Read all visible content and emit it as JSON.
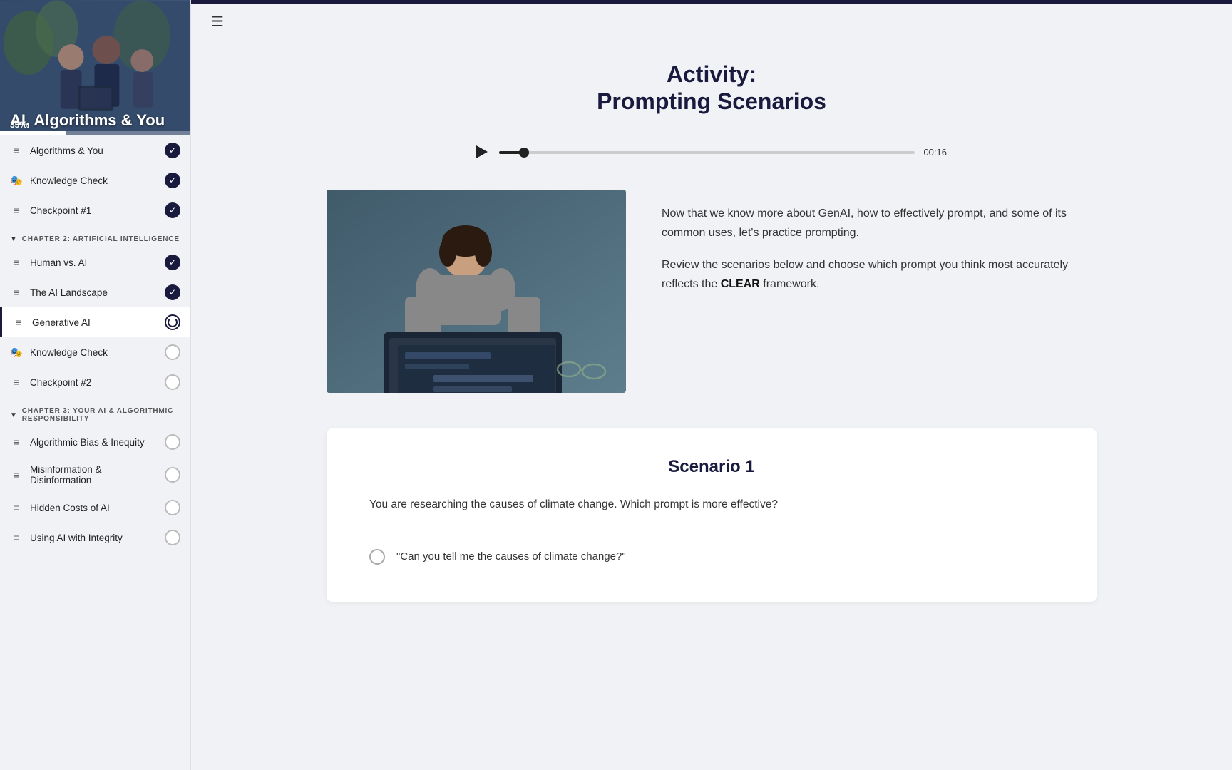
{
  "sidebar": {
    "hero": {
      "title": "AI, Algorithms & You",
      "progress_percent": 35,
      "progress_label": "35%"
    },
    "chapters": [
      {
        "type": "items",
        "items": [
          {
            "id": "algorithms-you",
            "label": "Algorithms & You",
            "icon": "≡",
            "status": "complete"
          },
          {
            "id": "knowledge-check-1",
            "label": "Knowledge Check",
            "icon": "🎭",
            "status": "complete"
          },
          {
            "id": "checkpoint-1",
            "label": "Checkpoint #1",
            "icon": "≡",
            "status": "complete"
          }
        ]
      },
      {
        "type": "chapter",
        "title": "CHAPTER 2: ARTIFICIAL INTELLIGENCE",
        "items": [
          {
            "id": "human-vs-ai",
            "label": "Human vs. AI",
            "icon": "≡",
            "status": "complete"
          },
          {
            "id": "ai-landscape",
            "label": "The AI Landscape",
            "icon": "≡",
            "status": "complete"
          },
          {
            "id": "generative-ai",
            "label": "Generative AI",
            "icon": "≡",
            "status": "in-progress",
            "active": true
          },
          {
            "id": "knowledge-check-2",
            "label": "Knowledge Check",
            "icon": "🎭",
            "status": "empty"
          },
          {
            "id": "checkpoint-2",
            "label": "Checkpoint #2",
            "icon": "≡",
            "status": "empty"
          }
        ]
      },
      {
        "type": "chapter",
        "title": "CHAPTER 3: YOUR AI & ALGORITHMIC RESPONSIBILITY",
        "items": [
          {
            "id": "algorithmic-bias",
            "label": "Algorithmic Bias & Inequity",
            "icon": "≡",
            "status": "empty"
          },
          {
            "id": "misinformation",
            "label": "Misinformation & Disinformation",
            "icon": "≡",
            "status": "empty"
          },
          {
            "id": "hidden-costs",
            "label": "Hidden Costs of AI",
            "icon": "≡",
            "status": "empty"
          },
          {
            "id": "using-ai-integrity",
            "label": "Using AI with Integrity",
            "icon": "≡",
            "status": "empty"
          }
        ]
      }
    ]
  },
  "main": {
    "page_title_line1": "Activity:",
    "page_title_line2": "Prompting Scenarios",
    "audio": {
      "time": "00:16"
    },
    "content_text_1": "Now that we know more about GenAI, how to effectively prompt, and some of its common uses, let's practice prompting.",
    "content_text_2": "Review the scenarios below and choose which prompt you think most accurately reflects the",
    "content_bold": "CLEAR",
    "content_text_2_end": "framework.",
    "scenario": {
      "title": "Scenario 1",
      "question": "You are researching the causes of climate change. Which prompt is more effective?",
      "options": [
        {
          "id": "opt-a",
          "text": "\"Can you tell me the causes of climate change?\""
        }
      ]
    }
  },
  "icons": {
    "hamburger": "☰",
    "chevron_down": "▼",
    "checkmark": "✓",
    "play": "▶"
  }
}
